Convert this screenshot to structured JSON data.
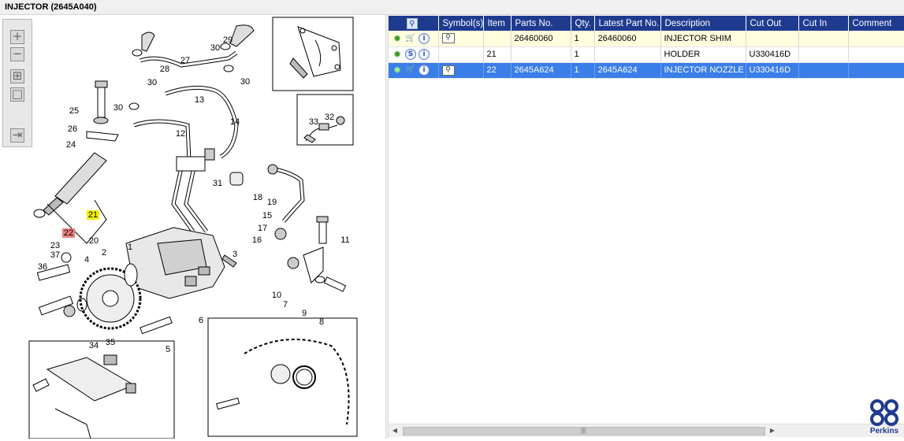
{
  "window": {
    "title": "INJECTOR (2645A040)"
  },
  "zoom_toolbar": {
    "buttons": [
      {
        "name": "zoom-in-button",
        "glyph": "+"
      },
      {
        "name": "zoom-out-button",
        "glyph": "−"
      },
      {
        "name": "fit-all-button",
        "glyph": "⊞"
      },
      {
        "name": "actual-size-button",
        "glyph": "□"
      },
      {
        "name": "show-list-button",
        "glyph": "⇥"
      }
    ]
  },
  "diagram": {
    "callouts": [
      "1",
      "2",
      "3",
      "4",
      "5",
      "6",
      "7",
      "8",
      "9",
      "10",
      "11",
      "12",
      "13",
      "14",
      "15",
      "16",
      "17",
      "18",
      "19",
      "20",
      "21",
      "22",
      "23",
      "24",
      "25",
      "26",
      "27",
      "28",
      "29",
      "30",
      "30",
      "30",
      "30",
      "31",
      "32",
      "33",
      "34",
      "35",
      "36",
      "37"
    ],
    "highlighted": {
      "yellow": "21",
      "red": "22"
    }
  },
  "parts_table": {
    "columns": [
      "",
      "Symbol(s)",
      "Item",
      "Parts No.",
      "Qty.",
      "Latest Part No.",
      "Description",
      "Cut Out",
      "Cut In",
      "Comment"
    ],
    "rows": [
      {
        "icons": [
          "gear-icon",
          "cart-icon",
          "info-icon"
        ],
        "symbol": "doc-view",
        "item": "",
        "part_no": "26460060",
        "qty": "1",
        "latest_part_no": "26460060",
        "description": "INJECTOR SHIM",
        "cut_out": "",
        "cut_in": "",
        "comment": ""
      },
      {
        "icons": [
          "gear-icon",
          "s-icon",
          "info-icon"
        ],
        "symbol": "",
        "item": "21",
        "part_no": "",
        "qty": "1",
        "latest_part_no": "",
        "description": "HOLDER",
        "cut_out": "U330416D",
        "cut_in": "",
        "comment": ""
      },
      {
        "icons": [
          "gear-icon",
          "cart-icon",
          "info-icon"
        ],
        "symbol": "doc-view",
        "item": "22",
        "part_no": "2645A624",
        "qty": "1",
        "latest_part_no": "2645A624",
        "description": "INJECTOR NOZZLE",
        "cut_out": "U330416D",
        "cut_in": "",
        "comment": ""
      }
    ],
    "selected_row_index": 2
  },
  "brand": {
    "name": "Perkins",
    "color": "#1f3b8f"
  },
  "colors": {
    "header_bg": "#1f3b8f",
    "selected_row": "#3a7ee8",
    "alt_row": "#ffffe0",
    "highlight_yellow": "#f4f000",
    "highlight_red": "#f08080"
  }
}
